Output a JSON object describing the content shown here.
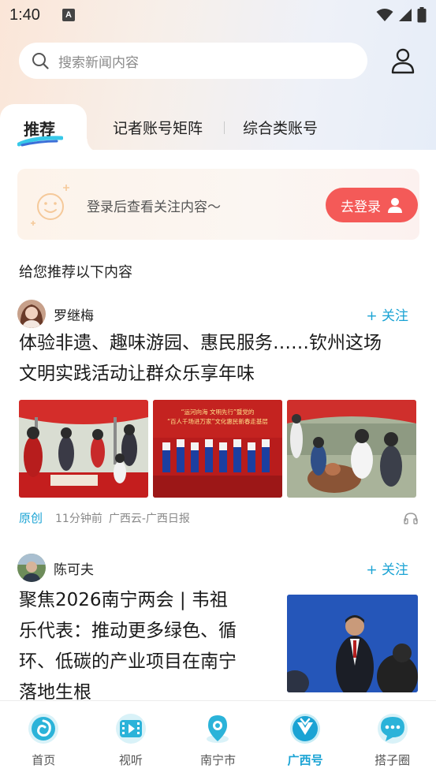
{
  "status_bar": {
    "time": "1:40",
    "notif_letter": "A"
  },
  "search": {
    "placeholder": "搜索新闻内容"
  },
  "tabs": [
    {
      "label": "推荐",
      "active": true
    },
    {
      "label": "记者账号矩阵",
      "active": false
    },
    {
      "label": "综合类账号",
      "active": false
    }
  ],
  "login_card": {
    "text": "登录后查看关注内容～",
    "button": "去登录"
  },
  "recommend_title": "给您推荐以下内容",
  "articles": [
    {
      "author": "罗继梅",
      "follow": "+ 关注",
      "headline_line1": "体验非遗、趣味游园、惠民服务……钦州这场",
      "headline_line2": "文明实践活动让群众乐享年味",
      "image_banner_text": "“运河向海 文明先行”暨党的… “百人千场进万家”文化惠民新春走基层",
      "meta": {
        "tag": "原创",
        "time": "11分钟前",
        "source": "广西云-广西日报"
      }
    },
    {
      "author": "陈可夫",
      "follow": "+ 关注",
      "headline_line1": "聚焦2026南宁两会 | 韦祖",
      "headline_line2": "乐代表：推动更多绿色、循",
      "headline_line3": "环、低碳的产业项目在南宁",
      "headline_line4": "落地生根"
    }
  ],
  "bottom_nav": [
    {
      "label": "首页",
      "icon": "home-icon",
      "active": false
    },
    {
      "label": "视听",
      "icon": "video-icon",
      "active": false
    },
    {
      "label": "南宁市",
      "icon": "location-icon",
      "active": false
    },
    {
      "label": "广西号",
      "icon": "guangxi-hao-icon",
      "active": true
    },
    {
      "label": "搭子圈",
      "icon": "chat-icon",
      "active": false
    }
  ],
  "colors": {
    "accent": "#1aa3d4",
    "login_button": "#f45a58"
  }
}
